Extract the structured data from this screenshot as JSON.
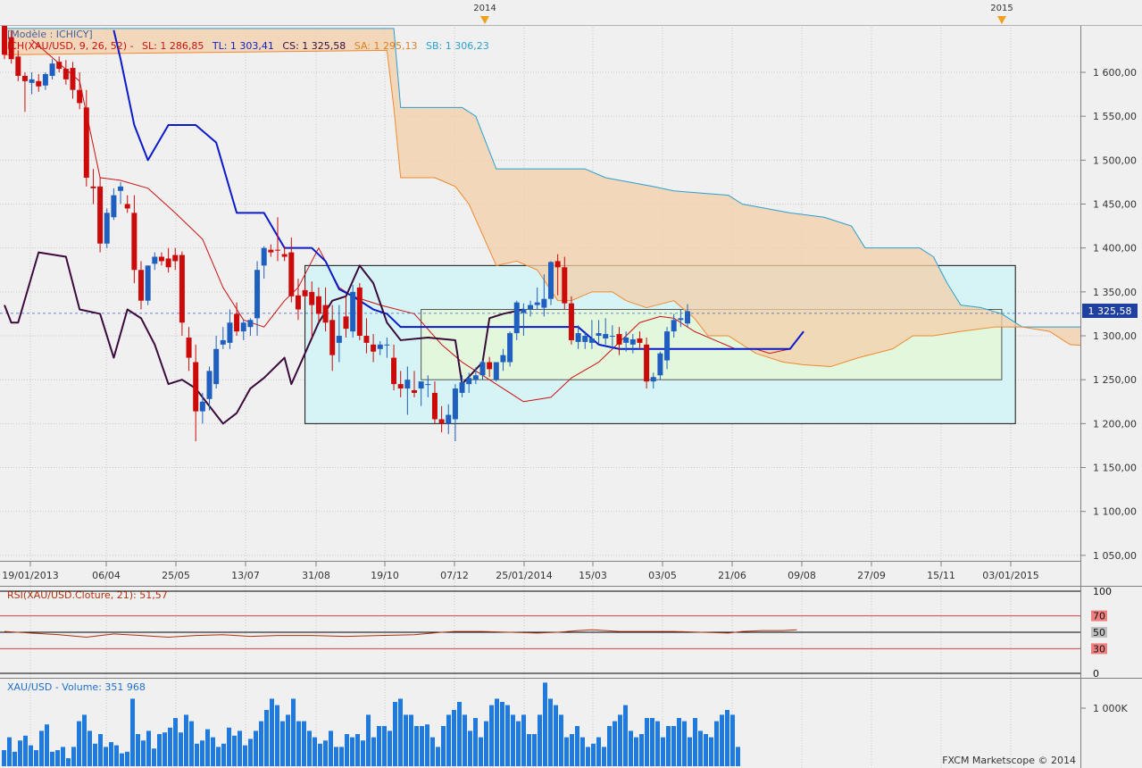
{
  "header": {
    "model_label": "[Modèle : ICHICY]",
    "ichimoku_label": "ICH(XAU/USD, 9, 26, 52) -",
    "sl": "SL: 1 286,85",
    "tl": "TL: 1 303,41",
    "cs": "CS: 1 325,58",
    "sa": "SA: 1 295,13",
    "sb": "SB: 1 306,23"
  },
  "year_markers": [
    "2014",
    "2015"
  ],
  "last_price_label": "1 325,58",
  "rsi_label": "RSI(XAU/USD.Cloture, 21): 51,57",
  "rsi_levels": [
    "100",
    "70",
    "50",
    "30",
    "0"
  ],
  "volume_label": "XAU/USD - Volume: 351 968",
  "volume_tick": "1 000K",
  "footer": "FXCM Marketscope © 2014",
  "colors": {
    "bull": "#1f5fbf",
    "bear": "#cc0a0a",
    "kijun": "#0a1acc",
    "tenkan": "#cc1010",
    "chikou": "#3a0a3a",
    "span_a": "#ee8a30",
    "span_b": "#2aa0d0",
    "cloud": "#f3cfa8",
    "box_outer": "#d6f3f5",
    "box_inner": "#e3f7dd",
    "volume": "#1f7ae0",
    "rsi": "#b03010"
  },
  "chart_data": {
    "type": "candlestick",
    "title": "",
    "y_ticks": [
      "1 600,00",
      "1 550,00",
      "1 500,00",
      "1 450,00",
      "1 400,00",
      "1 350,00",
      "1 300,00",
      "1 250,00",
      "1 200,00",
      "1 150,00",
      "1 100,00",
      "1 050,00"
    ],
    "ylim": [
      1040,
      1650
    ],
    "x_tick_labels": [
      "19/01/2013",
      "06/04",
      "25/05",
      "13/07",
      "31/08",
      "19/10",
      "07/12",
      "25/01/2014",
      "15/03",
      "03/05",
      "21/06",
      "09/08",
      "27/09",
      "15/11",
      "03/01/2015"
    ],
    "candles": [
      [
        1660,
        1665,
        1615,
        1620
      ],
      [
        1640,
        1648,
        1610,
        1615
      ],
      [
        1618,
        1625,
        1590,
        1596
      ],
      [
        1596,
        1600,
        1555,
        1590
      ],
      [
        1588,
        1600,
        1575,
        1592
      ],
      [
        1590,
        1598,
        1578,
        1584
      ],
      [
        1585,
        1600,
        1580,
        1598
      ],
      [
        1596,
        1615,
        1592,
        1610
      ],
      [
        1612,
        1618,
        1600,
        1604
      ],
      [
        1604,
        1614,
        1586,
        1592
      ],
      [
        1605,
        1612,
        1570,
        1580
      ],
      [
        1580,
        1600,
        1558,
        1565
      ],
      [
        1560,
        1580,
        1470,
        1480
      ],
      [
        1470,
        1490,
        1450,
        1468
      ],
      [
        1470,
        1480,
        1395,
        1405
      ],
      [
        1405,
        1445,
        1400,
        1440
      ],
      [
        1435,
        1468,
        1432,
        1460
      ],
      [
        1465,
        1475,
        1450,
        1470
      ],
      [
        1450,
        1460,
        1440,
        1445
      ],
      [
        1440,
        1460,
        1360,
        1375
      ],
      [
        1375,
        1385,
        1330,
        1340
      ],
      [
        1340,
        1380,
        1335,
        1380
      ],
      [
        1382,
        1395,
        1375,
        1390
      ],
      [
        1390,
        1395,
        1380,
        1385
      ],
      [
        1388,
        1400,
        1372,
        1378
      ],
      [
        1392,
        1400,
        1375,
        1385
      ],
      [
        1392,
        1396,
        1300,
        1315
      ],
      [
        1298,
        1310,
        1260,
        1275
      ],
      [
        1270,
        1290,
        1180,
        1214
      ],
      [
        1214,
        1235,
        1200,
        1225
      ],
      [
        1228,
        1265,
        1215,
        1260
      ],
      [
        1245,
        1300,
        1240,
        1285
      ],
      [
        1290,
        1310,
        1285,
        1295
      ],
      [
        1292,
        1330,
        1285,
        1315
      ],
      [
        1325,
        1338,
        1300,
        1305
      ],
      [
        1305,
        1318,
        1295,
        1315
      ],
      [
        1310,
        1320,
        1300,
        1318
      ],
      [
        1320,
        1385,
        1300,
        1375
      ],
      [
        1380,
        1402,
        1365,
        1400
      ],
      [
        1398,
        1404,
        1390,
        1395
      ],
      [
        1398,
        1435,
        1385,
        1397
      ],
      [
        1393,
        1402,
        1385,
        1390
      ],
      [
        1395,
        1412,
        1338,
        1345
      ],
      [
        1346,
        1365,
        1318,
        1330
      ],
      [
        1352,
        1362,
        1342,
        1345
      ],
      [
        1350,
        1362,
        1298,
        1335
      ],
      [
        1345,
        1355,
        1315,
        1325
      ],
      [
        1335,
        1355,
        1305,
        1315
      ],
      [
        1318,
        1335,
        1260,
        1278
      ],
      [
        1292,
        1335,
        1270,
        1300
      ],
      [
        1322,
        1345,
        1298,
        1308
      ],
      [
        1305,
        1358,
        1298,
        1350
      ],
      [
        1355,
        1360,
        1295,
        1300
      ],
      [
        1300,
        1320,
        1280,
        1292
      ],
      [
        1290,
        1302,
        1270,
        1282
      ],
      [
        1285,
        1294,
        1278,
        1290
      ],
      [
        1290,
        1298,
        1275,
        1290
      ],
      [
        1275,
        1290,
        1238,
        1245
      ],
      [
        1245,
        1260,
        1230,
        1240
      ],
      [
        1240,
        1265,
        1210,
        1250
      ],
      [
        1238,
        1260,
        1230,
        1235
      ],
      [
        1240,
        1248,
        1220,
        1248
      ],
      [
        1245,
        1255,
        1230,
        1245
      ],
      [
        1235,
        1248,
        1200,
        1205
      ],
      [
        1205,
        1220,
        1190,
        1200
      ],
      [
        1200,
        1222,
        1188,
        1210
      ],
      [
        1205,
        1245,
        1180,
        1240
      ],
      [
        1235,
        1255,
        1230,
        1247
      ],
      [
        1245,
        1258,
        1235,
        1252
      ],
      [
        1250,
        1264,
        1245,
        1255
      ],
      [
        1255,
        1272,
        1250,
        1270
      ],
      [
        1270,
        1276,
        1253,
        1262
      ],
      [
        1250,
        1268,
        1248,
        1270
      ],
      [
        1270,
        1285,
        1260,
        1278
      ],
      [
        1270,
        1305,
        1265,
        1303
      ],
      [
        1303,
        1340,
        1295,
        1338
      ],
      [
        1326,
        1337,
        1300,
        1330
      ],
      [
        1330,
        1340,
        1322,
        1335
      ],
      [
        1335,
        1355,
        1330,
        1338
      ],
      [
        1332,
        1370,
        1322,
        1342
      ],
      [
        1342,
        1385,
        1335,
        1384
      ],
      [
        1385,
        1393,
        1346,
        1378
      ],
      [
        1378,
        1390,
        1330,
        1337
      ],
      [
        1337,
        1345,
        1290,
        1295
      ],
      [
        1293,
        1312,
        1285,
        1303
      ],
      [
        1293,
        1305,
        1285,
        1300
      ],
      [
        1292,
        1318,
        1285,
        1297
      ],
      [
        1300,
        1318,
        1290,
        1303
      ],
      [
        1297,
        1320,
        1290,
        1302
      ],
      [
        1300,
        1312,
        1285,
        1300
      ],
      [
        1302,
        1310,
        1278,
        1290
      ],
      [
        1292,
        1305,
        1282,
        1298
      ],
      [
        1290,
        1302,
        1280,
        1296
      ],
      [
        1297,
        1305,
        1285,
        1292
      ],
      [
        1290,
        1298,
        1240,
        1248
      ],
      [
        1248,
        1258,
        1240,
        1253
      ],
      [
        1255,
        1282,
        1250,
        1280
      ],
      [
        1272,
        1310,
        1262,
        1305
      ],
      [
        1305,
        1325,
        1298,
        1318
      ],
      [
        1318,
        1330,
        1310,
        1320
      ],
      [
        1314,
        1336,
        1310,
        1328
      ]
    ],
    "tenkan": [
      [
        4,
        1637
      ],
      [
        11,
        1590
      ],
      [
        14,
        1480
      ],
      [
        17,
        1477
      ],
      [
        21,
        1468
      ],
      [
        25,
        1440
      ],
      [
        29,
        1410
      ],
      [
        32,
        1355
      ],
      [
        35,
        1318
      ],
      [
        38,
        1310
      ],
      [
        41,
        1340
      ],
      [
        43,
        1355
      ],
      [
        46,
        1400
      ],
      [
        49,
        1355
      ],
      [
        51,
        1345
      ],
      [
        55,
        1335
      ],
      [
        60,
        1325
      ],
      [
        64,
        1290
      ],
      [
        67,
        1270
      ],
      [
        70,
        1255
      ],
      [
        73,
        1240
      ],
      [
        76,
        1225
      ],
      [
        80,
        1230
      ],
      [
        83,
        1252
      ],
      [
        87,
        1270
      ],
      [
        91,
        1300
      ],
      [
        93,
        1315
      ],
      [
        96,
        1322
      ],
      [
        98,
        1320
      ],
      [
        101,
        1305
      ],
      [
        104,
        1295
      ],
      [
        107,
        1285
      ],
      [
        110,
        1285
      ],
      [
        112,
        1280
      ],
      [
        115,
        1285
      ]
    ],
    "kijun": [
      [
        16,
        1648
      ],
      [
        17,
        1615
      ],
      [
        19,
        1540
      ],
      [
        21,
        1500
      ],
      [
        24,
        1540
      ],
      [
        28,
        1540
      ],
      [
        31,
        1520
      ],
      [
        34,
        1440
      ],
      [
        38,
        1440
      ],
      [
        41,
        1400
      ],
      [
        45,
        1400
      ],
      [
        47,
        1385
      ],
      [
        49,
        1353
      ],
      [
        51,
        1345
      ],
      [
        54,
        1330
      ],
      [
        56,
        1325
      ],
      [
        58,
        1310
      ],
      [
        72,
        1310
      ],
      [
        84,
        1310
      ],
      [
        87,
        1290
      ],
      [
        90,
        1285
      ],
      [
        110,
        1285
      ],
      [
        115,
        1285
      ],
      [
        117,
        1305
      ]
    ],
    "chikou": [
      [
        0,
        1335
      ],
      [
        1,
        1315
      ],
      [
        2,
        1315
      ],
      [
        5,
        1395
      ],
      [
        9,
        1390
      ],
      [
        11,
        1330
      ],
      [
        14,
        1325
      ],
      [
        16,
        1275
      ],
      [
        18,
        1330
      ],
      [
        20,
        1320
      ],
      [
        22,
        1290
      ],
      [
        24,
        1245
      ],
      [
        26,
        1250
      ],
      [
        28,
        1240
      ],
      [
        32,
        1200
      ],
      [
        34,
        1212
      ],
      [
        36,
        1240
      ],
      [
        38,
        1252
      ],
      [
        41,
        1275
      ],
      [
        42,
        1245
      ],
      [
        44,
        1280
      ],
      [
        46,
        1315
      ],
      [
        48,
        1340
      ],
      [
        50,
        1345
      ],
      [
        52,
        1380
      ],
      [
        54,
        1360
      ],
      [
        56,
        1315
      ],
      [
        58,
        1295
      ],
      [
        62,
        1298
      ],
      [
        66,
        1295
      ],
      [
        67,
        1245
      ],
      [
        70,
        1270
      ],
      [
        71,
        1320
      ],
      [
        73,
        1325
      ],
      [
        76,
        1330
      ]
    ],
    "span_a": [
      [
        0,
        1620
      ],
      [
        56,
        1625
      ],
      [
        57,
        1560
      ],
      [
        58,
        1480
      ],
      [
        60,
        1480
      ],
      [
        63,
        1480
      ],
      [
        66,
        1470
      ],
      [
        68,
        1450
      ],
      [
        72,
        1380
      ],
      [
        75,
        1385
      ],
      [
        78,
        1375
      ],
      [
        81,
        1340
      ],
      [
        83,
        1340
      ],
      [
        86,
        1350
      ],
      [
        89,
        1350
      ],
      [
        91,
        1340
      ],
      [
        94,
        1332
      ],
      [
        98,
        1340
      ],
      [
        101,
        1320
      ],
      [
        103,
        1300
      ],
      [
        106,
        1300
      ],
      [
        110,
        1280
      ],
      [
        114,
        1270
      ],
      [
        117,
        1267
      ],
      [
        121,
        1265
      ],
      [
        125,
        1275
      ],
      [
        130,
        1285
      ],
      [
        133,
        1300
      ],
      [
        136,
        1300
      ],
      [
        140,
        1305
      ],
      [
        145,
        1310
      ],
      [
        149,
        1310
      ],
      [
        153,
        1305
      ],
      [
        156,
        1290
      ],
      [
        160,
        1288
      ],
      [
        162,
        1295
      ]
    ],
    "span_b": [
      [
        0,
        1650
      ],
      [
        57,
        1650
      ],
      [
        58,
        1560
      ],
      [
        67,
        1560
      ],
      [
        69,
        1550
      ],
      [
        72,
        1490
      ],
      [
        85,
        1490
      ],
      [
        88,
        1480
      ],
      [
        95,
        1470
      ],
      [
        98,
        1465
      ],
      [
        106,
        1460
      ],
      [
        108,
        1450
      ],
      [
        115,
        1440
      ],
      [
        120,
        1435
      ],
      [
        124,
        1425
      ],
      [
        126,
        1400
      ],
      [
        134,
        1400
      ],
      [
        136,
        1390
      ],
      [
        138,
        1360
      ],
      [
        140,
        1335
      ],
      [
        143,
        1332
      ],
      [
        146,
        1325
      ],
      [
        149,
        1310
      ],
      [
        152,
        1310
      ],
      [
        156,
        1310
      ],
      [
        160,
        1310
      ]
    ],
    "zones": [
      {
        "x": [
          44,
          148
        ],
        "y": [
          1200,
          1380
        ]
      },
      {
        "x": [
          61,
          146
        ],
        "y": [
          1250,
          1330
        ]
      }
    ],
    "volume": [
      10,
      18,
      9,
      16,
      19,
      13,
      10,
      22,
      26,
      9,
      10,
      12,
      5,
      12,
      28,
      32,
      22,
      14,
      20,
      12,
      15,
      13,
      8,
      9,
      42,
      20,
      16,
      22,
      11,
      20,
      21,
      24,
      30,
      21,
      32,
      28,
      14,
      16,
      23,
      18,
      12,
      14,
      24,
      19,
      22,
      13,
      17,
      22,
      28,
      35,
      42,
      38,
      28,
      32,
      42,
      28,
      28,
      22,
      18,
      14,
      16,
      22,
      12,
      12,
      20,
      18,
      20,
      16,
      32,
      18,
      25,
      25,
      22,
      40,
      42,
      32,
      32,
      25,
      25,
      26,
      18,
      12,
      25,
      32,
      35,
      40,
      32,
      22,
      30,
      18,
      28,
      38,
      42,
      40,
      38,
      32,
      28,
      32,
      20,
      20,
      32,
      52,
      42,
      38,
      32,
      18,
      20,
      25,
      18,
      12,
      14,
      18,
      12,
      25,
      28,
      32,
      38,
      22,
      18,
      20,
      30,
      30,
      28,
      18,
      25,
      25,
      30,
      28,
      18,
      30,
      22,
      20,
      18,
      28,
      32,
      35,
      32,
      12
    ],
    "rsi": [
      [
        0,
        51
      ],
      [
        8,
        47
      ],
      [
        12,
        44
      ],
      [
        16,
        48
      ],
      [
        20,
        46
      ],
      [
        24,
        44
      ],
      [
        28,
        46
      ],
      [
        32,
        47
      ],
      [
        36,
        45
      ],
      [
        40,
        46
      ],
      [
        45,
        46
      ],
      [
        50,
        45
      ],
      [
        55,
        46
      ],
      [
        60,
        47
      ],
      [
        64,
        50
      ],
      [
        66,
        51
      ],
      [
        70,
        51
      ],
      [
        74,
        50
      ],
      [
        78,
        49
      ],
      [
        81,
        50
      ],
      [
        84,
        52
      ],
      [
        86,
        53
      ],
      [
        88,
        52
      ],
      [
        90,
        51
      ],
      [
        94,
        51
      ],
      [
        98,
        51
      ],
      [
        102,
        50
      ],
      [
        106,
        49
      ],
      [
        108,
        51
      ],
      [
        111,
        52
      ],
      [
        114,
        52
      ],
      [
        116,
        53
      ]
    ]
  }
}
